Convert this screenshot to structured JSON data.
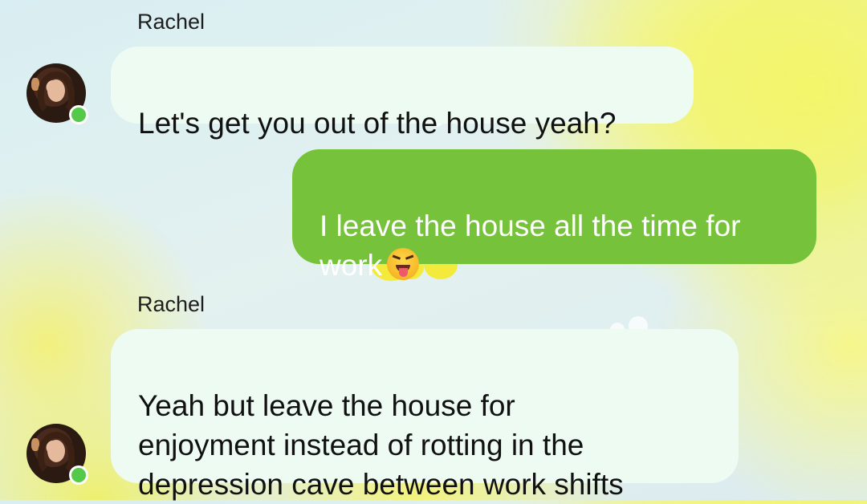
{
  "conversation": {
    "messages": [
      {
        "sender": "Rachel",
        "direction": "incoming",
        "text": "Let's get you out of the house yeah?",
        "status": "online"
      },
      {
        "direction": "outgoing",
        "text": "I leave the house all the time for\nwork",
        "emoji": "squinting-face-with-tongue"
      },
      {
        "sender": "Rachel",
        "direction": "incoming",
        "text": "Yeah but leave the house for\nenjoyment instead of rotting in the\ndepression cave between work shifts",
        "status": "online"
      }
    ]
  },
  "colors": {
    "outgoing_bubble": "#76c23a",
    "incoming_bubble": "#edfbf3",
    "online_dot": "#55c94a"
  }
}
